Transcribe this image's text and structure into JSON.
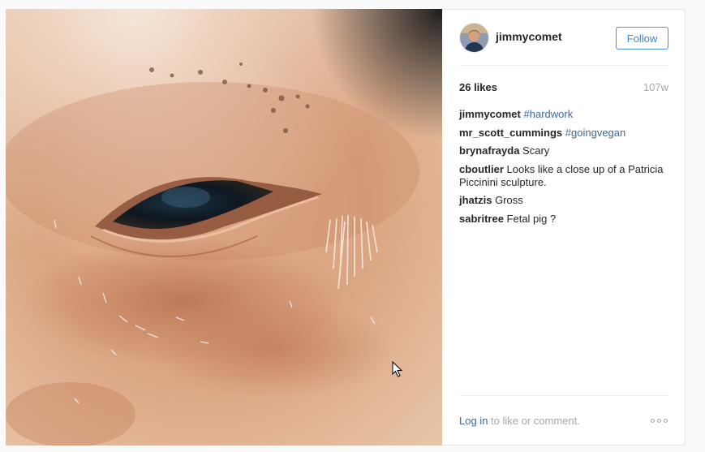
{
  "post": {
    "photo_alt": "",
    "author": {
      "username": "jimmycomet",
      "follow_label": "Follow"
    },
    "likes_text": "26 likes",
    "age": "107w",
    "comments": [
      {
        "user": "jimmycomet",
        "text": "",
        "tag": "#hardwork"
      },
      {
        "user": "mr_scott_cummings",
        "text": "",
        "tag": "#goingvegan"
      },
      {
        "user": "brynafrayda",
        "text": "Scary",
        "tag": ""
      },
      {
        "user": "cboutlier",
        "text": "Looks like a close up of a Patricia Piccinini sculpture.",
        "tag": ""
      },
      {
        "user": "jhatzis",
        "text": "Gross",
        "tag": ""
      },
      {
        "user": "sabritree",
        "text": "Fetal pig ?",
        "tag": ""
      }
    ],
    "footer": {
      "login_label": "Log in",
      "rest_text": " to like or comment."
    }
  },
  "icons": {
    "more": "more-options-icon",
    "cursor": "mouse-cursor-icon"
  },
  "colors": {
    "link_blue": "#3e6896",
    "follow_blue": "#3f88cc",
    "muted_gray": "#a5a7aa",
    "text_dark": "#262626"
  }
}
